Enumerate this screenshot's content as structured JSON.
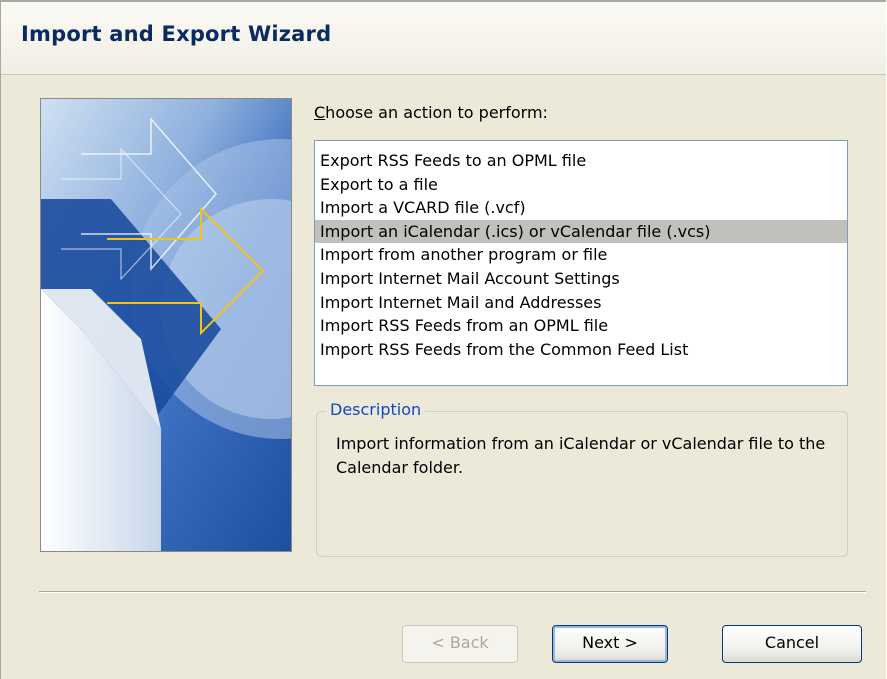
{
  "window": {
    "title": "Import and Export Wizard"
  },
  "prompt": {
    "accel": "C",
    "rest": "hoose an action to perform:"
  },
  "actions": [
    {
      "label": "Export RSS Feeds to an OPML file",
      "selected": false
    },
    {
      "label": "Export to a file",
      "selected": false
    },
    {
      "label": "Import a VCARD file (.vcf)",
      "selected": false
    },
    {
      "label": "Import an iCalendar (.ics) or vCalendar file (.vcs)",
      "selected": true
    },
    {
      "label": "Import from another program or file",
      "selected": false
    },
    {
      "label": "Import Internet Mail Account Settings",
      "selected": false
    },
    {
      "label": "Import Internet Mail and Addresses",
      "selected": false
    },
    {
      "label": "Import RSS Feeds from an OPML file",
      "selected": false
    },
    {
      "label": "Import RSS Feeds from the Common Feed List",
      "selected": false
    }
  ],
  "description": {
    "legend": "Description",
    "text": "Import information from an iCalendar or vCalendar file to the Calendar folder."
  },
  "buttons": {
    "back": "< Back",
    "next": "Next >",
    "cancel": "Cancel"
  },
  "colors": {
    "dialog_bg": "#ece9d8",
    "title": "#0a2a64",
    "legend": "#1046c8",
    "selection": "#c1c0ba"
  }
}
